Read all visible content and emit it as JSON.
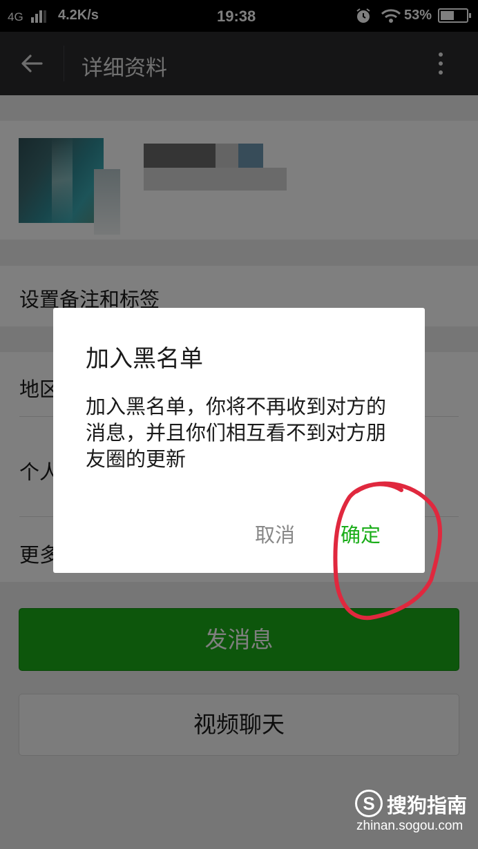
{
  "status_bar": {
    "network": "4G",
    "speed": "4.2K/s",
    "time": "19:38",
    "battery": "53%",
    "battery_level": 0.53,
    "icons": [
      "signal-icon",
      "alarm-icon",
      "wifi-icon",
      "battery-icon"
    ]
  },
  "header": {
    "back_icon": "arrow-left-icon",
    "title": "详细资料",
    "more_icon": "more-vertical-icon"
  },
  "menu": {
    "remark_tags": "设置备注和标签",
    "region": "地区",
    "signature": "个人",
    "more": "更多"
  },
  "buttons": {
    "send_message": "发消息",
    "video_chat": "视频聊天"
  },
  "dialog": {
    "title": "加入黑名单",
    "message": "加入黑名单，你将不再收到对方的消息，并且你们相互看不到对方朋友圈的更新",
    "cancel": "取消",
    "confirm": "确定"
  },
  "watermark": {
    "logo_letter": "S",
    "brand": "搜狗指南",
    "url": "zhinan.sogou.com"
  },
  "colors": {
    "accent_green": "#1aad19",
    "annotation_red": "#e0283e",
    "header_bg": "#2b2b2d"
  }
}
